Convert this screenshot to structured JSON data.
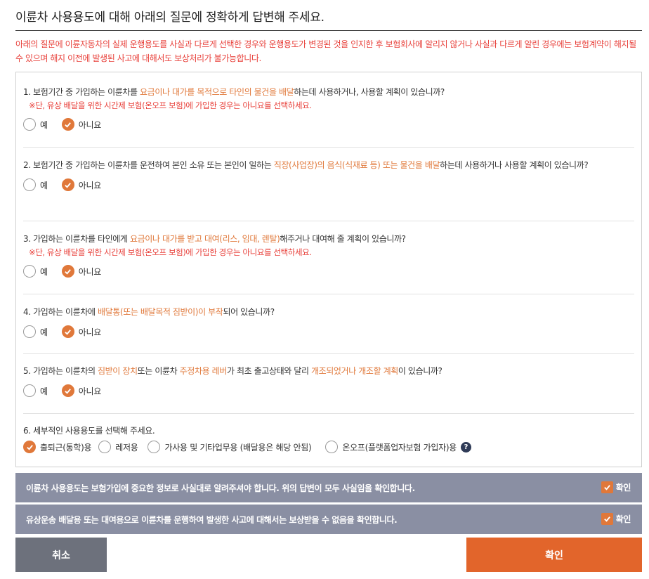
{
  "title": "이륜차 사용용도에 대해 아래의 질문에 정확하게 답변해 주세요.",
  "warning": "아래의 질문에 이륜자동차의 실제 운행용도를 사실과 다르게 선택한 경우와 운행용도가 변경된 것을 인지한 후 보험회사에 알리지 않거나 사실과 다르게 알린 경우에는 보험계약이 해지될 수 있으며 해지 이전에 발생된 사고에 대해서도 보상처리가 불가능합니다.",
  "q1": {
    "p1": "1. 보험기간 중 가입하는 이륜차를 ",
    "h1": "요금이나 대가를 목적으로 타인의 물건을 배달",
    "p2": "하는데 사용하거나, 사용할 계획이 있습니까?",
    "note": "※단, 유상 배달을 위한 시간제 보험(온오프 보험)에 가입한 경우는 아니요를 선택하세요.",
    "opt_yes": "예",
    "opt_no": "아니요",
    "selected": "아니요"
  },
  "q2": {
    "p1": "2. 보험기간 중 가입하는 이륜차를 운전하여 본인 소유 또는 본인이 일하는 ",
    "h1": "직장(사업장)의 음식(식재료 등) 또는 물건을 배달",
    "p2": "하는데 사용하거나 사용할 계획이 있습니까?",
    "opt_yes": "예",
    "opt_no": "아니요",
    "selected": "아니요"
  },
  "q3": {
    "p1": "3. 가입하는 이륜차를 타인에게 ",
    "h1": "요금이나 대가를 받고 대여(리스, 임대, 렌탈)",
    "p2": "해주거나 대여해 줄 계획이 있습니까?",
    "note": "※단, 유상 배달을 위한 시간제 보험(온오프 보험)에 가입한 경우는 아니요를 선택하세요.",
    "opt_yes": "예",
    "opt_no": "아니요",
    "selected": "아니요"
  },
  "q4": {
    "p1": "4. 가입하는 이륜차에 ",
    "h1": "배달통(또는 배달목적 짐받이)이 부착",
    "p2": "되어 있습니까?",
    "opt_yes": "예",
    "opt_no": "아니요",
    "selected": "아니요"
  },
  "q5": {
    "p1": "5. 가입하는 이륜차의 ",
    "h1": "짐받이 장치",
    "p2": "또는 이륜차 ",
    "h2": "주정차용 레버",
    "p3": "가 최초 출고상태와 달리 ",
    "h3": "개조되었거나 개조할 계획",
    "p4": "이 있습니까?",
    "opt_yes": "예",
    "opt_no": "아니요",
    "selected": "아니요"
  },
  "q6": {
    "text": "6. 세부적인 사용용도를 선택해 주세요.",
    "options": [
      "출퇴근(통학)용",
      "레저용",
      "가사용 및 기타업무용 (배달용은 해당 안됨)",
      "온오프(플랫폼업자보험 가입자)용"
    ],
    "selected": "출퇴근(통학)용",
    "help_glyph": "?"
  },
  "confirm1": {
    "text": "이륜차 사용용도는 보험가입에 중요한 정보로 사실대로 알려주셔야 합니다. 위의 답변이 모두 사실임을 확인합니다.",
    "label": "확인",
    "checked": true
  },
  "confirm2": {
    "text": "유상운송 배달용 또는 대여용으로 이륜차를 운행하여 발생한 사고에 대해서는 보상받을 수 없음을 확인합니다.",
    "label": "확인",
    "checked": true
  },
  "buttons": {
    "cancel": "취소",
    "ok": "확인"
  },
  "colors": {
    "accent": "#e0783a",
    "warning": "#e8413b",
    "confirm_bar": "#8a8fa3",
    "cancel_button": "#6d717c",
    "ok_button": "#e2652b"
  }
}
